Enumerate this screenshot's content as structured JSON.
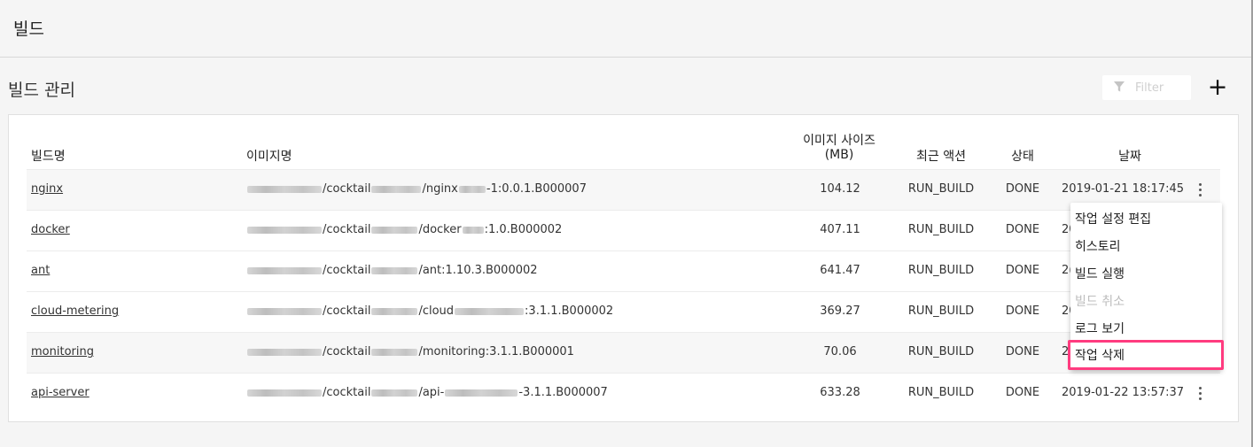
{
  "topbar": {
    "title": "빌드"
  },
  "section": {
    "title": "빌드 관리"
  },
  "filter": {
    "placeholder": "Filter",
    "icon": "filter-icon"
  },
  "add_button": {
    "label": "+"
  },
  "table": {
    "headers": {
      "build_name": "빌드명",
      "image_name": "이미지명",
      "image_size_line1": "이미지 사이즈",
      "image_size_line2": "(MB)",
      "last_action": "최근 액션",
      "status": "상태",
      "date": "날짜"
    },
    "rows": [
      {
        "name": "nginx",
        "image_prefix": "/cocktail",
        "image_mid": "/nginx",
        "image_suffix": "-1:0.0.1.B000007",
        "size": "104.12",
        "action": "RUN_BUILD",
        "status": "DONE",
        "date": "2019-01-21 18:17:45"
      },
      {
        "name": "docker",
        "image_prefix": "/cocktail",
        "image_mid": "/docker",
        "image_suffix": ":1.0.B000002",
        "size": "407.11",
        "action": "RUN_BUILD",
        "status": "DONE",
        "date": "20"
      },
      {
        "name": "ant",
        "image_prefix": "/cocktail",
        "image_mid": "",
        "image_suffix": "/ant:1.10.3.B000002",
        "size": "641.47",
        "action": "RUN_BUILD",
        "status": "DONE",
        "date": "2("
      },
      {
        "name": "cloud-metering",
        "image_prefix": "/cocktail",
        "image_mid": "/cloud",
        "image_suffix": ":3.1.1.B000002",
        "size": "369.27",
        "action": "RUN_BUILD",
        "status": "DONE",
        "date": "20"
      },
      {
        "name": "monitoring",
        "image_prefix": "/cocktail",
        "image_mid": "",
        "image_suffix": "/monitoring:3.1.1.B000001",
        "size": "70.06",
        "action": "RUN_BUILD",
        "status": "DONE",
        "date": "2"
      },
      {
        "name": "api-server",
        "image_prefix": "/cocktail",
        "image_mid": "/api-",
        "image_suffix": "-3.1.1.B000007",
        "size": "633.28",
        "action": "RUN_BUILD",
        "status": "DONE",
        "date": "2019-01-22 13:57:37"
      }
    ]
  },
  "context_menu": {
    "items": [
      {
        "label": "작업 설정 편집",
        "enabled": true
      },
      {
        "label": "히스토리",
        "enabled": true
      },
      {
        "label": "빌드 실행",
        "enabled": true
      },
      {
        "label": "빌드 취소",
        "enabled": false
      },
      {
        "label": "로그 보기",
        "enabled": true
      },
      {
        "label": "작업 삭제",
        "enabled": true,
        "highlighted": true
      }
    ]
  },
  "colors": {
    "highlight_border": "#ff3b7f",
    "background": "#f5f5f5",
    "card": "#ffffff"
  }
}
